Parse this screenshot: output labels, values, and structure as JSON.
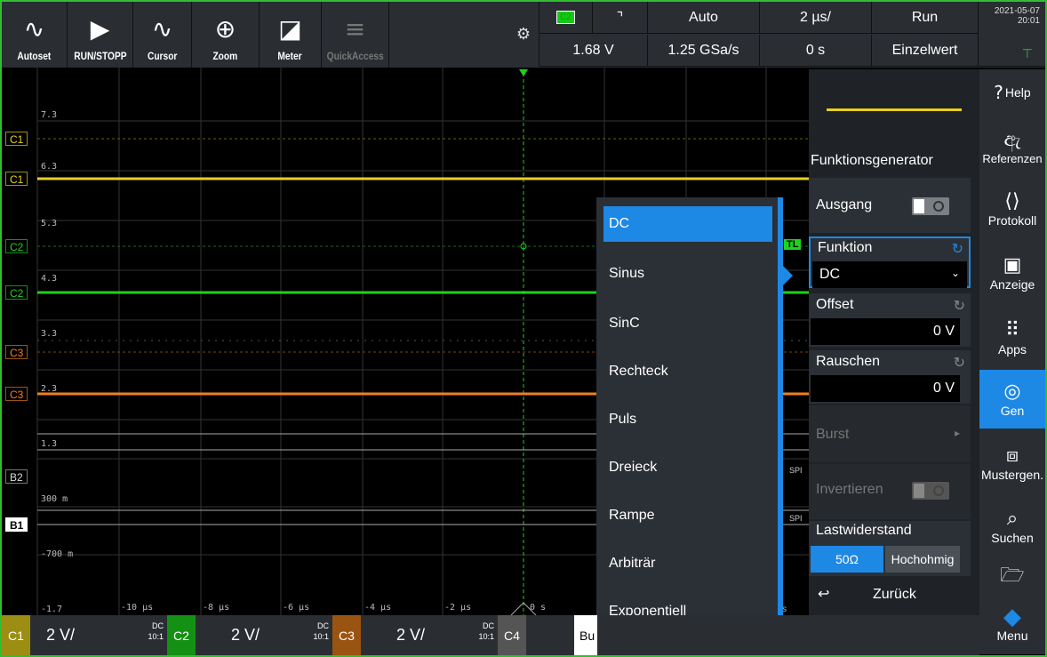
{
  "toolbar": {
    "buttons": [
      {
        "label": "Autoset",
        "icon": "autoset-icon"
      },
      {
        "label": "RUN/STOPP",
        "icon": "play-icon"
      },
      {
        "label": "Cursor",
        "icon": "cursor-icon"
      },
      {
        "label": "Zoom",
        "icon": "zoom-icon"
      },
      {
        "label": "Meter",
        "icon": "meter-icon"
      },
      {
        "label": "QuickAccess",
        "icon": "quickaccess-icon"
      }
    ]
  },
  "status": {
    "trigger_source": "C2",
    "trigger_slope": "⌝",
    "trigger_mode": "Auto",
    "time_scale": "2 µs/",
    "run_state": "Run",
    "trigger_level": "1.68 V",
    "sample_rate": "1.25 GSa/s",
    "time_offset": "0 s",
    "acq_mode": "Einzelwert",
    "date": "2021-05-07",
    "time": "20:01"
  },
  "grid": {
    "y_labels": [
      "7.3",
      "6.3",
      "5.3",
      "4.3",
      "3.3",
      "2.3",
      "1.3",
      "300 m",
      "-700 m",
      "-1.7"
    ],
    "x_labels": [
      "-10 µs",
      "-8 µs",
      "-6 µs",
      "-4 µs",
      "-2 µs",
      "0 s"
    ],
    "channel_markers": [
      "C1",
      "C1",
      "C2",
      "C2",
      "C3",
      "C3",
      "B2",
      "B1"
    ],
    "side_tags": [
      "TL",
      "SPI",
      "SPI",
      "s"
    ]
  },
  "dropdown": {
    "items": [
      "DC",
      "Sinus",
      "SinC",
      "Rechteck",
      "Puls",
      "Dreieck",
      "Rampe",
      "Arbiträr",
      "Exponentiell"
    ],
    "selected": "DC"
  },
  "panel": {
    "title": "Funktionsgenerator",
    "ausgang_label": "Ausgang",
    "funktion_label": "Funktion",
    "funktion_value": "DC",
    "offset_label": "Offset",
    "offset_value": "0 V",
    "rauschen_label": "Rauschen",
    "rauschen_value": "0 V",
    "burst_label": "Burst",
    "invertieren_label": "Invertieren",
    "lastwiderstand_label": "Lastwiderstand",
    "last_options": [
      "50Ω",
      "Hochohmig"
    ],
    "back_label": "Zurück"
  },
  "nav": {
    "items": [
      {
        "label": "Help",
        "icon": "help-icon"
      },
      {
        "label": "Referenzen",
        "icon": "reference-icon"
      },
      {
        "label": "Protokoll",
        "icon": "protocol-icon"
      },
      {
        "label": "Anzeige",
        "icon": "display-icon"
      },
      {
        "label": "Apps",
        "icon": "apps-icon"
      },
      {
        "label": "Gen",
        "icon": "generator-icon"
      },
      {
        "label": "Mustergen.",
        "icon": "pattern-generator-icon"
      },
      {
        "label": "Suchen",
        "icon": "search-icon"
      },
      {
        "label": "",
        "icon": "folder-icon"
      },
      {
        "label": "Menu",
        "icon": "rs-logo-icon"
      }
    ],
    "active": "Gen"
  },
  "bottom": {
    "channels": [
      {
        "name": "C1",
        "scale": "2 V/",
        "coupling": "DC",
        "probe": "10:1"
      },
      {
        "name": "C2",
        "scale": "2 V/",
        "coupling": "DC",
        "probe": "10:1"
      },
      {
        "name": "C3",
        "scale": "2 V/",
        "coupling": "DC",
        "probe": "10:1"
      },
      {
        "name": "C4",
        "scale": "",
        "coupling": "",
        "probe": ""
      }
    ],
    "bus_label": "Bu"
  },
  "colors": {
    "c1": "#e8d020",
    "c2": "#1ed21e",
    "c3": "#f08020",
    "accent": "#1e88e5",
    "frame": "#2fbf2f"
  }
}
